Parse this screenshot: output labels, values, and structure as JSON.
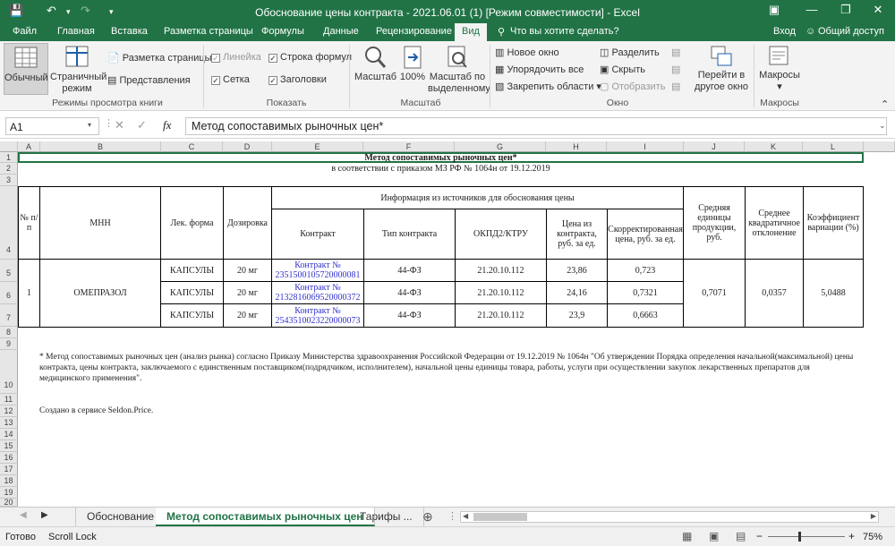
{
  "titlebar": {
    "title": "Обоснование цены контракта - 2021.06.01 (1)  [Режим совместимости] - Excel"
  },
  "tabs": {
    "file": "Файл",
    "home": "Главная",
    "insert": "Вставка",
    "layout": "Разметка страницы",
    "formulas": "Формулы",
    "data": "Данные",
    "review": "Рецензирование",
    "view": "Вид",
    "tellme": "Что вы хотите сделать?",
    "login": "Вход",
    "share": "Общий доступ"
  },
  "ribbon": {
    "normal": "Обычный",
    "pagebreak": "Страничный режим",
    "pagelayout": "Разметка страницы",
    "custom": "Представления",
    "grp_views": "Режимы просмотра книги",
    "ruler": "Линейка",
    "formulabar": "Строка формул",
    "gridlines": "Сетка",
    "headings": "Заголовки",
    "grp_show": "Показать",
    "zoom": "Масштаб",
    "zoom100": "100%",
    "zoomsel": "Масштаб по выделенному",
    "grp_zoom": "Масштаб",
    "newwin": "Новое окно",
    "arrange": "Упорядочить все",
    "freeze": "Закрепить области",
    "split": "Разделить",
    "hide": "Скрыть",
    "unhide": "Отобразить",
    "switch": "Перейти в другое окно",
    "grp_window": "Окно",
    "macros": "Макросы",
    "grp_macros": "Макросы"
  },
  "formulabar": {
    "namebox": "A1",
    "fx": "fx",
    "content": "Метод сопоставимых рыночных цен*"
  },
  "columns": [
    "A",
    "B",
    "C",
    "D",
    "E",
    "F",
    "G",
    "H",
    "I",
    "J",
    "K",
    "L"
  ],
  "rows": [
    "1",
    "2",
    "3",
    "4",
    "5",
    "6",
    "7",
    "8",
    "9",
    "10",
    "11",
    "12",
    "13",
    "14",
    "15",
    "16",
    "17",
    "18",
    "19",
    "20"
  ],
  "sheet": {
    "title": "Метод сопоставимых рыночных цен*",
    "subtitle": "в соответствии с приказом МЗ РФ № 1064н от 19.12.2019",
    "h_num": "№ п/п",
    "h_mnn": "МНН",
    "h_form": "Лек. форма",
    "h_dose": "Дозировка",
    "h_info": "Информация из источников для обоснования цены",
    "h_contract": "Контракт",
    "h_type": "Тип контракта",
    "h_okpd": "ОКПД2/КТРУ",
    "h_price": "Цена из контракта, руб. за ед.",
    "h_adj": "Скорректированная цена, руб. за ед.",
    "h_avg": "Средняя единицы продукции, руб.",
    "h_std": "Среднее квадратичное отклонение",
    "h_var": "Коэффициент вариации (%)",
    "num": "1",
    "mnn": "ОМЕПРАЗОЛ",
    "avg": "0,7071",
    "std": "0,0357",
    "var": "5,0488",
    "rows": [
      {
        "form": "КАПСУЛЫ",
        "dose": "20 мг",
        "contract": "Контракт № 2351500105720000081",
        "type": "44-ФЗ",
        "okpd": "21.20.10.112",
        "price": "23,86",
        "adj": "0,723"
      },
      {
        "form": "КАПСУЛЫ",
        "dose": "20 мг",
        "contract": "Контракт № 2132816069520000372",
        "type": "44-ФЗ",
        "okpd": "21.20.10.112",
        "price": "24,16",
        "adj": "0,7321"
      },
      {
        "form": "КАПСУЛЫ",
        "dose": "20 мг",
        "contract": "Контракт № 2543510023220000073",
        "type": "44-ФЗ",
        "okpd": "21.20.10.112",
        "price": "23,9",
        "adj": "0,6663"
      }
    ],
    "note": "* Метод сопоставимых рыночных цен (анализ рынка) согласно Приказу Министерства здравоохранения Российской Федерации от 19.12.2019 № 1064н \"Об утверждении Порядка определения начальной(максимальной) цены контракта, цены контракта, заключаемого с единственным поставщиком(подрядчиком, исполнителем), начальной цены единицы товара, работы, услуги при осуществлении закупок лекарственных препаратов для медицинского применения\".",
    "footer": "Создано в сервисе Seldon.Price."
  },
  "sheettabs": [
    "Обоснование",
    "Метод сопоставимых рыночных цен",
    "Тарифы ..."
  ],
  "status": {
    "ready": "Готово",
    "scroll": "Scroll Lock",
    "zoom": "75%"
  }
}
